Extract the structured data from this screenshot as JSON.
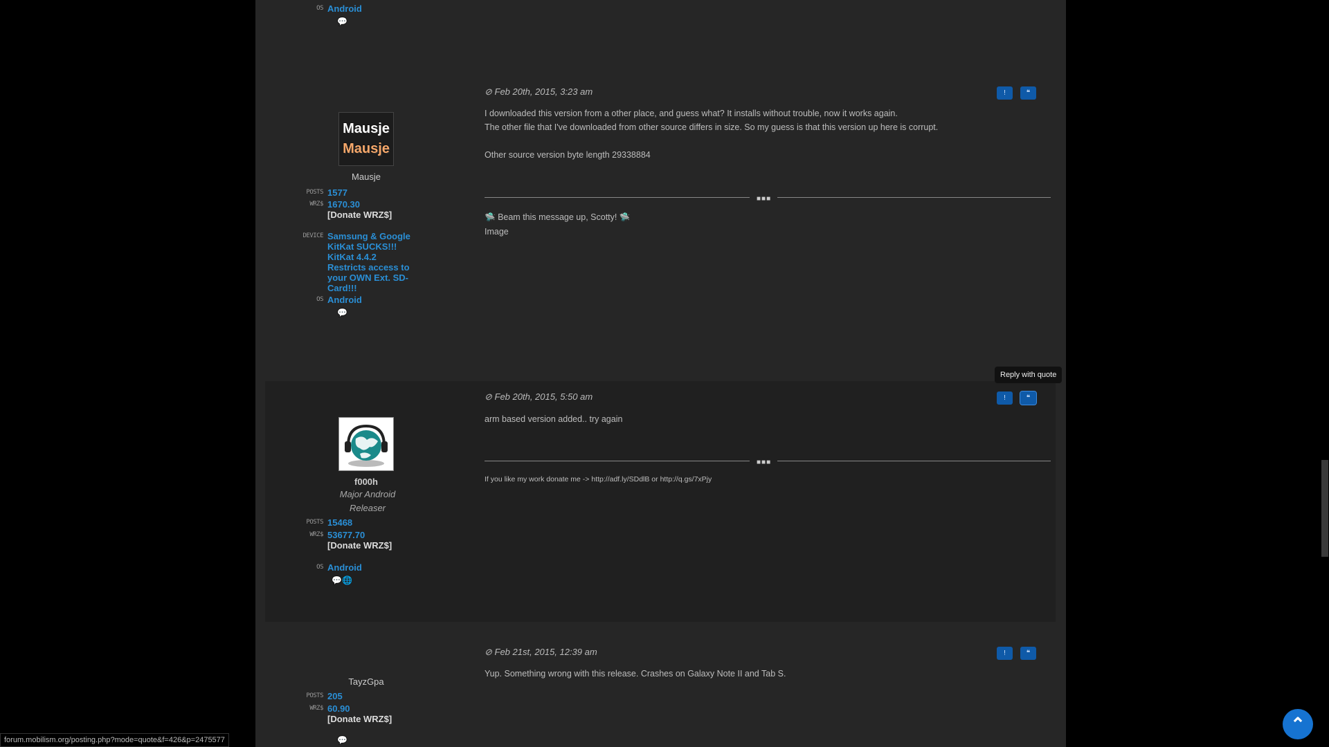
{
  "top_tail": {
    "os_label": "OS",
    "os_value": "Android",
    "contact_icon": "comment-icon"
  },
  "posts": [
    {
      "date": "Feb 20th, 2015, 3:23 am",
      "date_icon": "clock-icon",
      "avatar_line1": "Mausje",
      "avatar_line2": "Mausje",
      "username": "Mausje",
      "posts_label": "POSTS",
      "posts_value": "1577",
      "wrzs_label": "WRZ$",
      "wrzs_value": "1670.30",
      "donate": "[Donate WRZ$]",
      "device_label": "DEVICE",
      "device_value": "Samsung & Google KitKat SUCKS!!! KitKat 4.4.2 Restricts access to your OWN Ext. SD-Card!!!",
      "os_label": "OS",
      "os_value": "Android",
      "message": [
        "I downloaded this version from a other place, and guess what? It installs without trouble, now it works again.",
        "The other file that I've downloaded from other source differs in size. So my guess is that this version up here is corrupt.",
        "",
        "Other source version byte length 29338884"
      ],
      "signature": [
        "Beam this message up, Scotty!",
        "Image"
      ]
    },
    {
      "date": "Feb 20th, 2015, 5:50 am",
      "date_icon": "clock-icon",
      "username": "f000h",
      "rank": "Major Android Releaser",
      "posts_label": "POSTS",
      "posts_value": "15468",
      "wrzs_label": "WRZ$",
      "wrzs_value": "53677.70",
      "donate": "[Donate WRZ$]",
      "os_label": "OS",
      "os_value": "Android",
      "message": [
        "arm based version added.. try again"
      ],
      "signature": [
        "If you like my work donate me -> http://adf.ly/SDdlB or http://q.gs/7xPjy"
      ]
    },
    {
      "date": "Feb 21st, 2015, 12:39 am",
      "date_icon": "clock-icon",
      "username": "TayzGpa",
      "posts_label": "POSTS",
      "posts_value": "205",
      "wrzs_label": "WRZ$",
      "wrzs_value": "60.90",
      "donate": "[Donate WRZ$]",
      "message": [
        "Yup. Something wrong with this release. Crashes on Galaxy Note II and Tab S."
      ]
    }
  ],
  "buttons": {
    "report_icon": "!",
    "quote_icon": "❝"
  },
  "tooltip": "Reply with quote",
  "status_url": "forum.mobilism.org/posting.php?mode=quote&f=426&p=2475577",
  "back_to_top_icon": "chevron-up-icon"
}
